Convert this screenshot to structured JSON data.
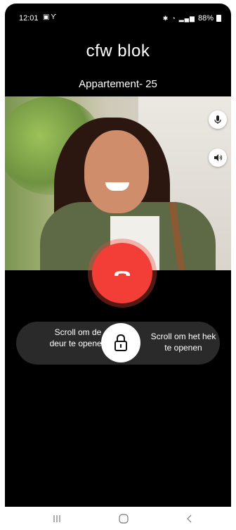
{
  "status_bar": {
    "time": "12:01",
    "left_icons": [
      "image-icon",
      "antenna-icon"
    ],
    "right_icons": [
      "bluetooth-icon",
      "wifi-icon",
      "signal-icon"
    ],
    "battery": "88%"
  },
  "header": {
    "title": "cfw blok",
    "apartment": "Appartement- 25"
  },
  "video": {
    "controls": [
      "microphone-icon",
      "speaker-icon"
    ]
  },
  "call": {
    "hangup_icon": "phone-hangup-icon",
    "hangup_color": "#f23e37"
  },
  "unlock": {
    "left_label": "Scroll om de deur te openen",
    "right_label": "Scroll om het hek te openen",
    "knob_icon": "lock-icon"
  },
  "navigation": [
    "recent-apps-icon",
    "home-icon",
    "back-icon"
  ]
}
